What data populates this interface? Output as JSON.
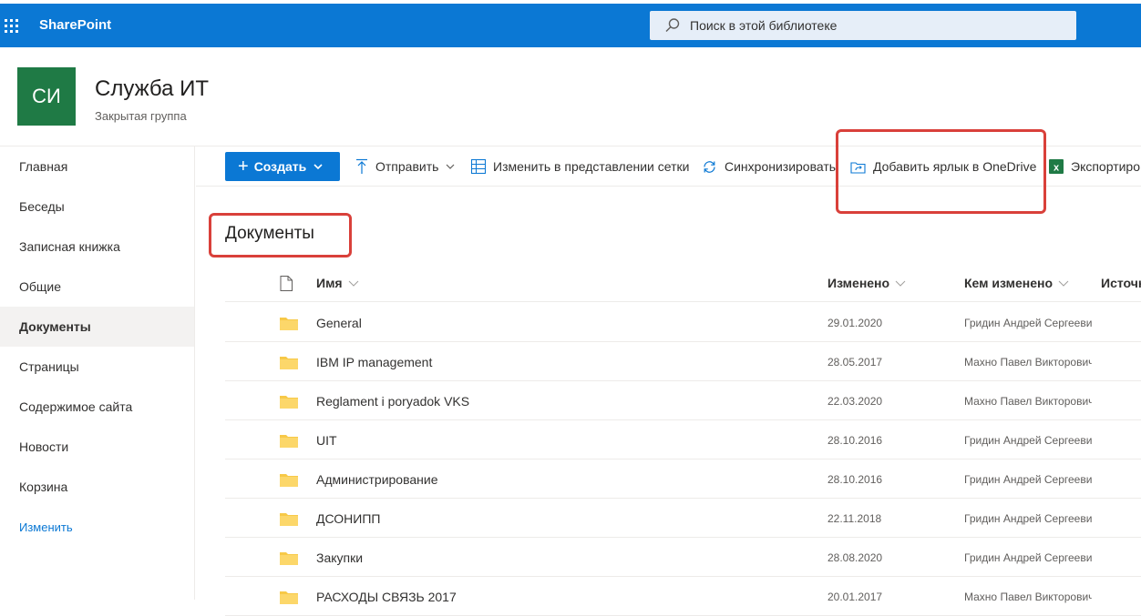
{
  "topbar": {
    "brand": "SharePoint",
    "search_placeholder": "Поиск в этой библиотеке",
    "accent": "#0b78d4"
  },
  "site": {
    "logo_initials": "СИ",
    "logo_color": "#1f7a45",
    "title": "Служба ИТ",
    "subtitle": "Закрытая группа"
  },
  "nav": {
    "items": [
      {
        "label": "Главная",
        "active": false
      },
      {
        "label": "Беседы",
        "active": false
      },
      {
        "label": "Записная книжка",
        "active": false
      },
      {
        "label": "Общие",
        "active": false
      },
      {
        "label": "Документы",
        "active": true
      },
      {
        "label": "Страницы",
        "active": false
      },
      {
        "label": "Содержимое сайта",
        "active": false
      },
      {
        "label": "Новости",
        "active": false
      },
      {
        "label": "Корзина",
        "active": false
      }
    ],
    "edit_label": "Изменить"
  },
  "commands": {
    "create": "Создать",
    "upload": "Отправить",
    "grid_edit": "Изменить в представлении сетки",
    "sync": "Синхронизировать",
    "add_shortcut": "Добавить ярлык в OneDrive",
    "export": "Экспортиро"
  },
  "library": {
    "title": "Документы",
    "columns": {
      "name": "Имя",
      "modified": "Изменено",
      "modified_by": "Кем изменено",
      "source": "Источн"
    },
    "rows": [
      {
        "name": "General",
        "modified": "29.01.2020",
        "modified_by": "Гридин Андрей Сергееви"
      },
      {
        "name": "IBM IP management",
        "modified": "28.05.2017",
        "modified_by": "Махно Павел Викторович"
      },
      {
        "name": "Reglament i poryadok VKS",
        "modified": "22.03.2020",
        "modified_by": "Махно Павел Викторович"
      },
      {
        "name": "UIT",
        "modified": "28.10.2016",
        "modified_by": "Гридин Андрей Сергееви"
      },
      {
        "name": "Администрирование",
        "modified": "28.10.2016",
        "modified_by": "Гридин Андрей Сергееви"
      },
      {
        "name": "ДСОНИПП",
        "modified": "22.11.2018",
        "modified_by": "Гридин Андрей Сергееви"
      },
      {
        "name": "Закупки",
        "modified": "28.08.2020",
        "modified_by": "Гридин Андрей Сергееви"
      },
      {
        "name": "РАСХОДЫ СВЯЗЬ 2017",
        "modified": "20.01.2017",
        "modified_by": "Махно Павел Викторович"
      }
    ]
  },
  "colors": {
    "highlight": "#d9403a",
    "folder": "#f7c948"
  }
}
